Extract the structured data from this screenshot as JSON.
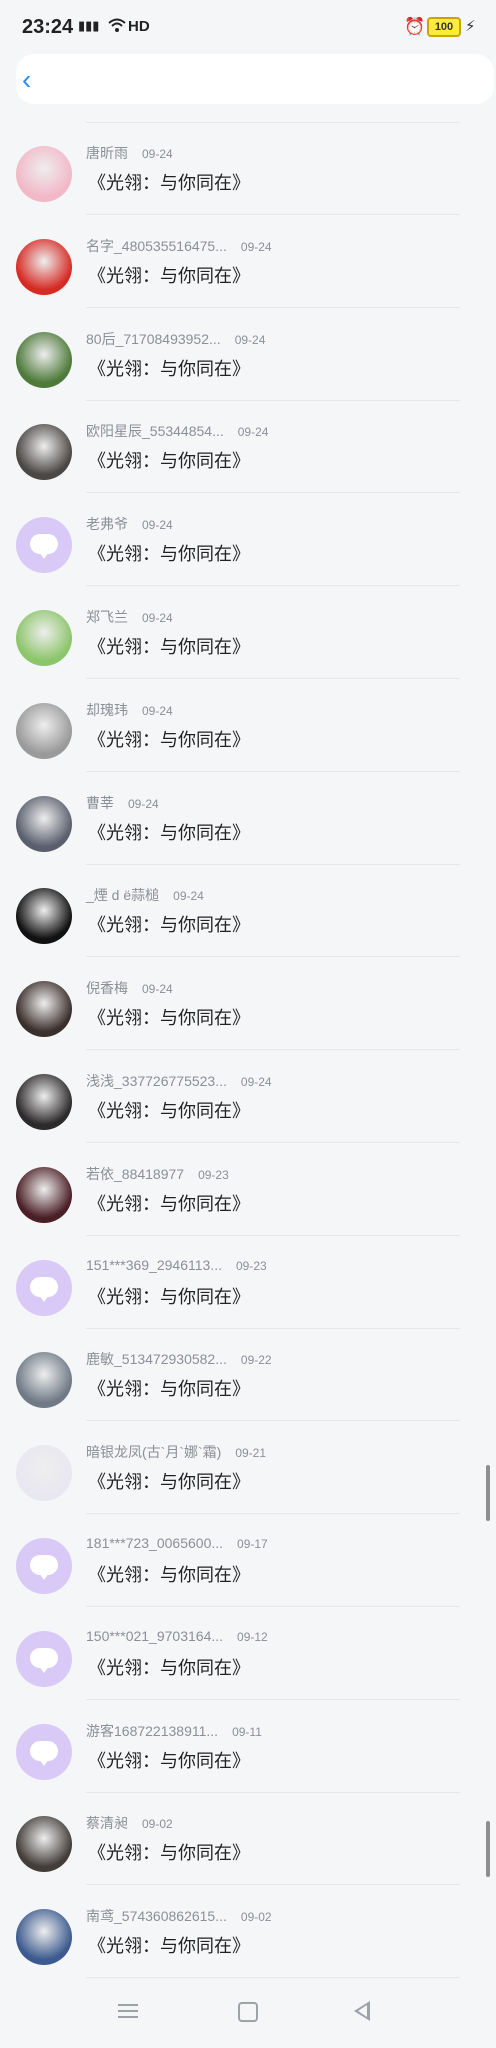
{
  "status_bar": {
    "time": "23:24",
    "network": "HD",
    "battery": "100"
  },
  "icons": {
    "back": "chevron-left-icon",
    "alarm": "alarm-icon",
    "battery": "battery-icon",
    "signal": "signal-icon",
    "wifi": "wifi-icon"
  },
  "colors": {
    "accent": "#2a8df0",
    "default_avatar": "#d8c9f6",
    "text_secondary": "#8b8f96",
    "background": "#f5f6f8"
  },
  "comments": [
    {
      "user": "唐昕雨",
      "date": "09-24",
      "text": "《光翎：与你同在》",
      "avatar": "#f2b8c8"
    },
    {
      "user": "名字_480535516475...",
      "date": "09-24",
      "text": "《光翎：与你同在》",
      "avatar": "#d62b24"
    },
    {
      "user": "80后_71708493952...",
      "date": "09-24",
      "text": "《光翎：与你同在》",
      "avatar": "#4e7a3a"
    },
    {
      "user": "欧阳星辰_55344854...",
      "date": "09-24",
      "text": "《光翎：与你同在》",
      "avatar": "#4b4744"
    },
    {
      "user": "老弗爷",
      "date": "09-24",
      "text": "《光翎：与你同在》",
      "avatar": "default"
    },
    {
      "user": "郑飞兰",
      "date": "09-24",
      "text": "《光翎：与你同在》",
      "avatar": "#8cc56a"
    },
    {
      "user": "却瑰玮",
      "date": "09-24",
      "text": "《光翎：与你同在》",
      "avatar": "#9a9a9a"
    },
    {
      "user": "曹莘",
      "date": "09-24",
      "text": "《光翎：与你同在》",
      "avatar": "#5a5f6e"
    },
    {
      "user": "_煙 d ë蒜槌",
      "date": "09-24",
      "text": "《光翎：与你同在》",
      "avatar": "#111111"
    },
    {
      "user": "倪香梅",
      "date": "09-24",
      "text": "《光翎：与你同在》",
      "avatar": "#3b2f2c"
    },
    {
      "user": "浅浅_337726775523...",
      "date": "09-24",
      "text": "《光翎：与你同在》",
      "avatar": "#2d2a2b"
    },
    {
      "user": "若依_88418977",
      "date": "09-23",
      "text": "《光翎：与你同在》",
      "avatar": "#4a1f26"
    },
    {
      "user": "151***369_2946113...",
      "date": "09-23",
      "text": "《光翎：与你同在》",
      "avatar": "default"
    },
    {
      "user": "鹿敏_513472930582...",
      "date": "09-22",
      "text": "《光翎：与你同在》",
      "avatar": "#6f7a86"
    },
    {
      "user": "暗银龙凤(古`月`娜`霜)",
      "date": "09-21",
      "text": "《光翎：与你同在》",
      "avatar": "#e9e7f0"
    },
    {
      "user": "181***723_0065600...",
      "date": "09-17",
      "text": "《光翎：与你同在》",
      "avatar": "default"
    },
    {
      "user": "150***021_9703164...",
      "date": "09-12",
      "text": "《光翎：与你同在》",
      "avatar": "default"
    },
    {
      "user": "游客168722138911...",
      "date": "09-11",
      "text": "《光翎：与你同在》",
      "avatar": "default"
    },
    {
      "user": "蔡清昶",
      "date": "09-02",
      "text": "《光翎：与你同在》",
      "avatar": "#433d3a"
    },
    {
      "user": "南鸢_574360862615...",
      "date": "09-02",
      "text": "《光翎：与你同在》",
      "avatar": "#3c5a8f"
    }
  ],
  "scroll_positions": [
    0.74,
    0.93
  ]
}
